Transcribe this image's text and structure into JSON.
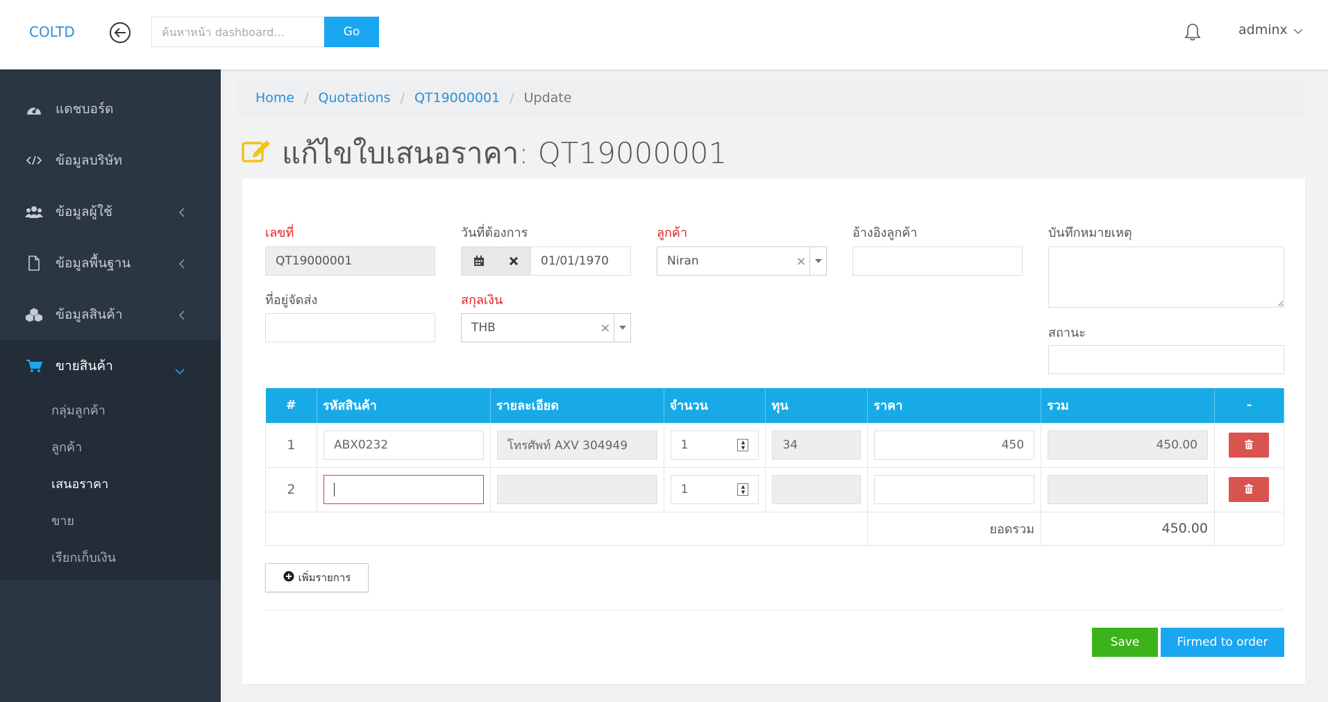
{
  "app": {
    "brand": "COLTD"
  },
  "search": {
    "placeholder": "ค้นหาหน้า dashboard...",
    "go_label": "Go"
  },
  "user": {
    "name": "adminx"
  },
  "sidebar": {
    "items": [
      {
        "label": "แดชบอร์ด",
        "icon": "dashboard-icon"
      },
      {
        "label": "ข้อมูลบริษัท",
        "icon": "code-icon"
      },
      {
        "label": "ข้อมูลผู้ใช้",
        "icon": "users-icon"
      },
      {
        "label": "ข้อมูลพื้นฐาน",
        "icon": "file-icon"
      },
      {
        "label": "ข้อมูลสินค้า",
        "icon": "cubes-icon"
      },
      {
        "label": "ขายสินค้า",
        "icon": "cart-icon"
      }
    ],
    "sub_items": [
      {
        "label": "กลุ่มลูกค้า"
      },
      {
        "label": "ลูกค้า"
      },
      {
        "label": "เสนอราคา"
      },
      {
        "label": "ขาย"
      },
      {
        "label": "เรียกเก็บเงิน"
      }
    ]
  },
  "breadcrumb": {
    "home": "Home",
    "quotations": "Quotations",
    "doc": "QT19000001",
    "current": "Update"
  },
  "page": {
    "title": "แก้ไขใบเสนอราคา: QT19000001"
  },
  "form": {
    "doc_no_label": "เลขที่",
    "doc_no_value": "QT19000001",
    "due_date_label": "วันที่ต้องการ",
    "due_date_value": "01/01/1970",
    "customer_label": "ลูกค้า",
    "customer_value": "Niran",
    "customer_ref_label": "อ้างอิงลูกค้า",
    "customer_ref_value": "",
    "note_label": "บันทึกหมายเหตุ",
    "note_value": "",
    "ship_address_label": "ที่อยู่จัดส่ง",
    "ship_address_value": "",
    "currency_label": "สกุลเงิน",
    "currency_value": "THB",
    "status_label": "สถานะ",
    "status_value": ""
  },
  "table": {
    "headers": {
      "num": "#",
      "code": "รหัสสินค้า",
      "detail": "รายละเอียด",
      "qty": "จำนวน",
      "cost": "ทุน",
      "price": "ราคา",
      "total": "รวม",
      "action": "-"
    },
    "rows": [
      {
        "num": "1",
        "code": "ABX0232",
        "detail": "โทรศัพท์ AXV 304949",
        "qty": "1",
        "cost": "34",
        "price": "450",
        "total": "450.00"
      },
      {
        "num": "2",
        "code": "",
        "detail": "",
        "qty": "1",
        "cost": "",
        "price": "",
        "total": ""
      }
    ],
    "grand_total_label": "ยอดรวม",
    "grand_total_value": "450.00"
  },
  "actions": {
    "add_item": "เพิ่มรายการ",
    "save": "Save",
    "firm": "Firmed to order"
  },
  "colors": {
    "primary": "#1aa6f0",
    "save": "#3db31b",
    "danger": "#d9534f",
    "sidebar": "#2a3642",
    "required": "#e02020",
    "icon_yellow": "#f0c419"
  }
}
